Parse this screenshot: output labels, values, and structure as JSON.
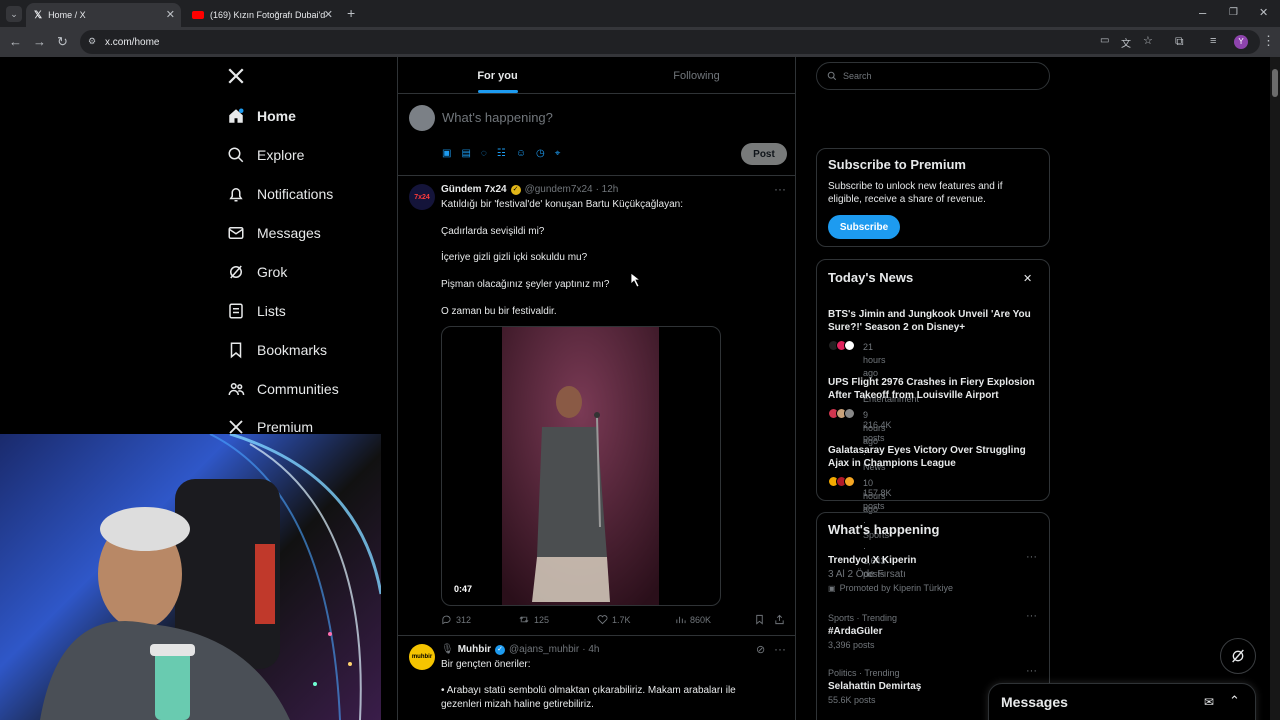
{
  "browser": {
    "tabs": [
      {
        "title": "Home / X",
        "active": true
      },
      {
        "title": "(169) Kızın Fotoğrafı Dubai'de",
        "active": false
      }
    ],
    "url": "x.com/home",
    "profile_initial": "Y"
  },
  "sidebar": {
    "items": [
      {
        "label": "Home",
        "icon": "home-icon"
      },
      {
        "label": "Explore",
        "icon": "search-icon"
      },
      {
        "label": "Notifications",
        "icon": "bell-icon"
      },
      {
        "label": "Messages",
        "icon": "mail-icon"
      },
      {
        "label": "Grok",
        "icon": "grok-icon"
      },
      {
        "label": "Lists",
        "icon": "list-icon"
      },
      {
        "label": "Bookmarks",
        "icon": "bookmark-icon"
      },
      {
        "label": "Communities",
        "icon": "people-icon"
      },
      {
        "label": "Premium",
        "icon": "x-logo-icon"
      }
    ]
  },
  "feed": {
    "tabs": {
      "for_you": "For you",
      "following": "Following"
    },
    "composer": {
      "placeholder": "What's happening?",
      "post_label": "Post"
    },
    "tweet1": {
      "name": "Gündem 7x24",
      "handle": "@gundem7x24",
      "time": "· 12h",
      "avatar_text": "7x24",
      "lines": [
        "Katıldığı bir 'festival'de' konuşan Bartu Küçükçağlayan:",
        "Çadırlarda sevişildi mi?",
        "İçeriye gizli gizli içki sokuldu mu?",
        "Pişman olacağınız şeyler yaptınız mı?",
        "O zaman bu bir festivaldir."
      ],
      "video_duration": "0:47",
      "replies": "312",
      "reposts": "125",
      "likes": "1.7K",
      "views": "860K"
    },
    "tweet2": {
      "name": "Muhbir",
      "handle": "@ajans_muhbir",
      "time": "· 4h",
      "avatar_text": "muhbir",
      "line1": "Bir gençten öneriler:",
      "line2": "• Arabayı statü sembolü olmaktan çıkarabiliriz. Makam arabaları ile",
      "line3": "gezenleri mizah haline getirebiliriz."
    }
  },
  "right": {
    "search_placeholder": "Search",
    "premium": {
      "title": "Subscribe to Premium",
      "text1": "Subscribe to unlock new features and if",
      "text2": "eligible, receive a share of revenue.",
      "button": "Subscribe"
    },
    "news": {
      "title": "Today's News",
      "items": [
        {
          "line1": "BTS's Jimin and Jungkook Unveil 'Are You",
          "line2": "Sure?!' Season 2 on Disney+",
          "meta": "21 hours ago · Entertainment · 216.4K posts"
        },
        {
          "line1": "UPS Flight 2976 Crashes in Fiery Explosion",
          "line2": "After Takeoff from Louisville Airport",
          "meta": "9 hours ago · News · 157.8K posts"
        },
        {
          "line1": "Galatasaray Eyes Victory Over Struggling",
          "line2": "Ajax in Champions League",
          "meta": "10 hours ago · Sports · 1,643 posts"
        }
      ]
    },
    "happening": {
      "title": "What's happening",
      "items": [
        {
          "context": "",
          "title": "Trendyol X Kiperin",
          "sub": "3 Al 2 Öde Fırsatı",
          "meta": "Promoted by Kiperin Türkiye"
        },
        {
          "context": "Sports · Trending",
          "title": "#ArdaGüler",
          "sub": "",
          "meta": "3,396 posts"
        },
        {
          "context": "Politics · Trending",
          "title": "Selahattin Demirtaş",
          "sub": "",
          "meta": "55.6K posts"
        }
      ]
    },
    "messages_drawer": "Messages"
  },
  "colors": {
    "accent": "#1d9bf0",
    "background": "#000000",
    "border": "#2f3336",
    "muted": "#71767b",
    "verified_gold": "#e2b719"
  }
}
